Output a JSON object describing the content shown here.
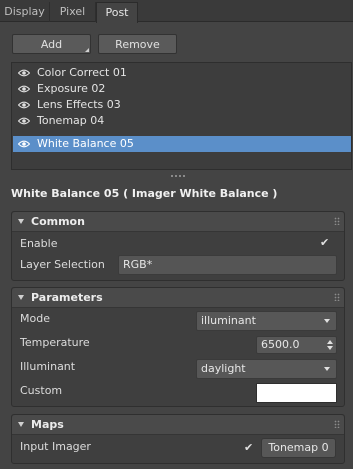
{
  "tabs": [
    {
      "label": "Display",
      "active": false
    },
    {
      "label": "Pixel",
      "active": false
    },
    {
      "label": "Post",
      "active": true
    }
  ],
  "toolbar": {
    "add_label": "Add",
    "remove_label": "Remove"
  },
  "effects_list": [
    {
      "label": "Color Correct 01",
      "visible_icon": "eye-icon",
      "selected": false
    },
    {
      "label": "Exposure 02",
      "visible_icon": "eye-icon",
      "selected": false
    },
    {
      "label": "Lens Effects 03",
      "visible_icon": "eye-icon",
      "selected": false
    },
    {
      "label": "Tonemap 04",
      "visible_icon": "eye-icon",
      "selected": false
    },
    {
      "label": "White Balance 05",
      "visible_icon": "eye-icon",
      "selected": true
    }
  ],
  "selected_title": "White Balance 05  ( Imager White Balance )",
  "common": {
    "title": "Common",
    "enable_label": "Enable",
    "enable_checked": true,
    "layer_selection_label": "Layer Selection",
    "layer_selection_value": "RGB*"
  },
  "parameters": {
    "title": "Parameters",
    "mode_label": "Mode",
    "mode_value": "illuminant",
    "temperature_label": "Temperature",
    "temperature_value": "6500.0",
    "illuminant_label": "Illuminant",
    "illuminant_value": "daylight",
    "custom_label": "Custom",
    "custom_color": "#ffffff"
  },
  "maps": {
    "title": "Maps",
    "input_imager_label": "Input Imager",
    "input_imager_checked": true,
    "input_imager_value": "Tonemap 0"
  },
  "colors": {
    "background": "#444444",
    "selection": "#5b8fc9"
  }
}
